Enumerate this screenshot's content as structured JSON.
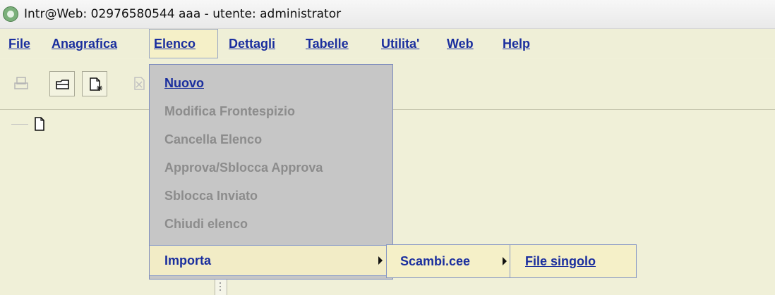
{
  "window": {
    "title": "Intr@Web: 02976580544  aaa - utente: administrator"
  },
  "menubar": {
    "items": [
      {
        "label": "File"
      },
      {
        "label": "Anagrafica"
      },
      {
        "label": "Elenco"
      },
      {
        "label": "Dettagli"
      },
      {
        "label": "Tabelle"
      },
      {
        "label": "Utilita'"
      },
      {
        "label": "Web"
      },
      {
        "label": "Help"
      }
    ],
    "active": "Elenco"
  },
  "toolbar": {
    "buttons": [
      {
        "icon": "print-icon",
        "enabled": false
      },
      {
        "icon": "open-folder-icon",
        "enabled": true
      },
      {
        "icon": "new-document-icon",
        "enabled": true
      },
      {
        "icon": "delete-document-icon",
        "enabled": false
      }
    ]
  },
  "elenco_menu": {
    "items": [
      {
        "label": "Nuovo",
        "enabled": true
      },
      {
        "label": "Modifica Frontespizio",
        "enabled": false
      },
      {
        "label": "Cancella Elenco",
        "enabled": false
      },
      {
        "label": "Approva/Sblocca Approva",
        "enabled": false
      },
      {
        "label": "Sblocca Inviato",
        "enabled": false
      },
      {
        "label": "Chiudi elenco",
        "enabled": false
      },
      {
        "label": "Importa",
        "enabled": true,
        "has_submenu": true
      }
    ]
  },
  "importa_submenu": {
    "items": [
      {
        "label": "Scambi.cee",
        "has_submenu": true
      }
    ]
  },
  "scambi_submenu": {
    "items": [
      {
        "label": "File singolo"
      }
    ]
  },
  "colors": {
    "menu_text": "#1a2e9e",
    "disabled_text": "#8c8c8c",
    "highlight": "#f2ecc6",
    "background": "#f0f0d8"
  }
}
